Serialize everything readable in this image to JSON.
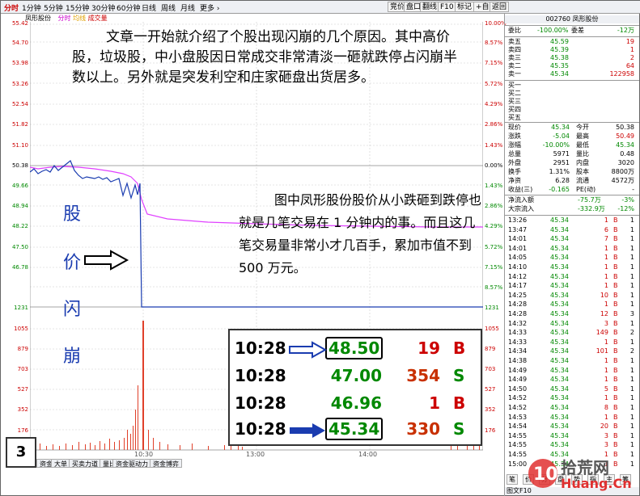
{
  "toolbar": {
    "tabs": [
      "分时",
      "1分钟",
      "5分钟",
      "15分钟",
      "30分钟",
      "60分钟",
      "日线",
      "周线",
      "月线",
      "更多 ›"
    ],
    "right_buttons": [
      "竞价",
      "盘口",
      "翻线",
      "F10",
      "标记",
      "+自选",
      "返回"
    ]
  },
  "chart_header": {
    "stock": "凤形股份",
    "mode1": "分时",
    "mode2": "均线",
    "mode3": "成交量"
  },
  "price_axis_left": [
    "55.42",
    "54.70",
    "53.98",
    "53.26",
    "52.54",
    "51.82",
    "51.10",
    "50.38",
    "49.66",
    "48.94",
    "48.22",
    "47.50",
    "46.78",
    "1231"
  ],
  "price_axis_right": [
    "10.00%",
    "8.57%",
    "7.15%",
    "5.72%",
    "4.29%",
    "2.86%",
    "1.43%",
    "0.00%",
    "1.43%",
    "2.86%",
    "4.29%",
    "5.72%",
    "7.15%",
    "8.57%",
    "1231"
  ],
  "volume_axis": [
    "1055",
    "879",
    "703",
    "527",
    "352",
    "176"
  ],
  "time_labels": [
    "10:30",
    "13:00",
    "14:00"
  ],
  "annotation_main": "文章一开始就介绍了个股出现闪崩的几个原因。其中高价股，垃圾股，中小盘股因日常成交非常清淡一砸就跌停占闪崩半数以上。另外就是突发利空和庄家砸盘出货居多。",
  "annotation_vertical": [
    "股",
    "价",
    "闪",
    "崩"
  ],
  "annotation_right": "图中凤形股份股价从小跌砸到跌停也就是几笔交易在 1 分钟内的事。而且这几笔交易量非常小才几百手，累加市值不到 500 万元。",
  "inset_rows": [
    {
      "time": "10:28",
      "price": "48.50",
      "vol": "19",
      "side": "B"
    },
    {
      "time": "10:28",
      "price": "47.00",
      "vol": "354",
      "side": "S"
    },
    {
      "time": "10:28",
      "price": "46.96",
      "vol": "1",
      "side": "B"
    },
    {
      "time": "10:28",
      "price": "45.34",
      "vol": "330",
      "side": "S"
    }
  ],
  "badge": "3",
  "bottom_tabs": [
    "资金",
    "大单",
    "买卖力道",
    "量比",
    "资金驱动力",
    "资金博弈"
  ],
  "panel": {
    "code_name": "002760 凤形股份",
    "commit": {
      "l1": "委比",
      "v1": "-100.00%",
      "l2": "委差",
      "v2": "-12万"
    },
    "asks": [
      {
        "l": "卖五",
        "p": "45.59",
        "v": "19"
      },
      {
        "l": "卖四",
        "p": "45.39",
        "v": "1"
      },
      {
        "l": "卖三",
        "p": "45.38",
        "v": "2"
      },
      {
        "l": "卖二",
        "p": "45.35",
        "v": "64"
      },
      {
        "l": "卖一",
        "p": "45.34",
        "v": "122958"
      }
    ],
    "bids": [
      "买一",
      "买二",
      "买三",
      "买四",
      "买五"
    ],
    "stats": [
      {
        "a": "现价",
        "av": "45.34",
        "b": "今开",
        "bv": "50.38"
      },
      {
        "a": "涨跌",
        "av": "-5.04",
        "b": "最高",
        "bv": "50.49"
      },
      {
        "a": "涨幅",
        "av": "-10.00%",
        "b": "最低",
        "bv": "45.34"
      },
      {
        "a": "总量",
        "av": "5971",
        "b": "量比",
        "bv": "0.48"
      },
      {
        "a": "外盘",
        "av": "2951",
        "b": "内盘",
        "bv": "3020"
      },
      {
        "a": "换手",
        "av": "1.31%",
        "b": "股本",
        "bv": "8800万"
      },
      {
        "a": "净资",
        "av": "6.28",
        "b": "流通",
        "bv": "4572万"
      },
      {
        "a": "收益(三)",
        "av": "-0.165",
        "b": "PE(动)",
        "bv": "-"
      }
    ],
    "flow": [
      {
        "l": "净流入额",
        "v": "-75.7万",
        "p": "-3%"
      },
      {
        "l": "大宗流入",
        "v": "-332.9万",
        "p": "-12%"
      }
    ],
    "ticks": [
      [
        "13:26",
        "45.34",
        "1",
        "B",
        "1"
      ],
      [
        "13:47",
        "45.34",
        "6",
        "B",
        "1"
      ],
      [
        "14:01",
        "45.34",
        "7",
        "B",
        "1"
      ],
      [
        "14:01",
        "45.34",
        "1",
        "B",
        "1"
      ],
      [
        "14:05",
        "45.34",
        "1",
        "B",
        "1"
      ],
      [
        "14:10",
        "45.34",
        "1",
        "B",
        "1"
      ],
      [
        "14:12",
        "45.34",
        "1",
        "B",
        "1"
      ],
      [
        "14:17",
        "45.34",
        "1",
        "B",
        "1"
      ],
      [
        "14:25",
        "45.34",
        "10",
        "B",
        "1"
      ],
      [
        "14:28",
        "45.34",
        "1",
        "B",
        "1"
      ],
      [
        "14:28",
        "45.34",
        "12",
        "B",
        "3"
      ],
      [
        "14:32",
        "45.34",
        "3",
        "B",
        "1"
      ],
      [
        "14:33",
        "45.34",
        "149",
        "B",
        "2"
      ],
      [
        "14:33",
        "45.34",
        "1",
        "B",
        "1"
      ],
      [
        "14:34",
        "45.34",
        "101",
        "B",
        "2"
      ],
      [
        "14:38",
        "45.34",
        "1",
        "B",
        "1"
      ],
      [
        "14:49",
        "45.34",
        "1",
        "B",
        "1"
      ],
      [
        "14:49",
        "45.34",
        "1",
        "B",
        "1"
      ],
      [
        "14:50",
        "45.34",
        "5",
        "B",
        "1"
      ],
      [
        "14:52",
        "45.34",
        "1",
        "B",
        "1"
      ],
      [
        "14:52",
        "45.34",
        "8",
        "B",
        "1"
      ],
      [
        "14:53",
        "45.34",
        "1",
        "B",
        "1"
      ],
      [
        "14:54",
        "45.34",
        "20",
        "B",
        "1"
      ],
      [
        "14:55",
        "45.34",
        "3",
        "B",
        "1"
      ],
      [
        "14:55",
        "45.34",
        "3",
        "B",
        "1"
      ],
      [
        "14:55",
        "45.34",
        "1",
        "B",
        "1"
      ],
      [
        "15:00",
        "45.34",
        "1",
        "B",
        "1"
      ]
    ],
    "bottom": [
      "笔",
      "价",
      "分",
      "盘",
      "势",
      "指",
      "主",
      "筹"
    ],
    "f10": "图文F10"
  },
  "watermark": {
    "num": "10",
    "text1": "拾荒网",
    "text2": "Huang.Cn"
  },
  "colors": {
    "price_line": "#1a3cb0",
    "avg_line": "#e040ff",
    "volume": "#e0402a",
    "up": "#c00000",
    "down": "#008000"
  }
}
